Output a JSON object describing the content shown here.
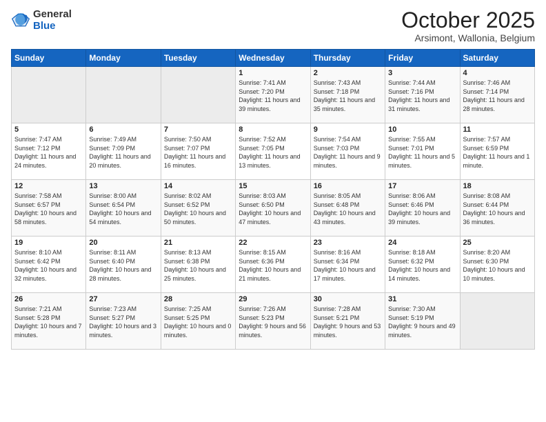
{
  "header": {
    "logo_general": "General",
    "logo_blue": "Blue",
    "month": "October 2025",
    "location": "Arsimont, Wallonia, Belgium"
  },
  "days_of_week": [
    "Sunday",
    "Monday",
    "Tuesday",
    "Wednesday",
    "Thursday",
    "Friday",
    "Saturday"
  ],
  "weeks": [
    [
      {
        "day": "",
        "empty": true
      },
      {
        "day": "",
        "empty": true
      },
      {
        "day": "",
        "empty": true
      },
      {
        "day": "1",
        "sunrise": "7:41 AM",
        "sunset": "7:20 PM",
        "daylight": "11 hours and 39 minutes."
      },
      {
        "day": "2",
        "sunrise": "7:43 AM",
        "sunset": "7:18 PM",
        "daylight": "11 hours and 35 minutes."
      },
      {
        "day": "3",
        "sunrise": "7:44 AM",
        "sunset": "7:16 PM",
        "daylight": "11 hours and 31 minutes."
      },
      {
        "day": "4",
        "sunrise": "7:46 AM",
        "sunset": "7:14 PM",
        "daylight": "11 hours and 28 minutes."
      }
    ],
    [
      {
        "day": "5",
        "sunrise": "7:47 AM",
        "sunset": "7:12 PM",
        "daylight": "11 hours and 24 minutes."
      },
      {
        "day": "6",
        "sunrise": "7:49 AM",
        "sunset": "7:09 PM",
        "daylight": "11 hours and 20 minutes."
      },
      {
        "day": "7",
        "sunrise": "7:50 AM",
        "sunset": "7:07 PM",
        "daylight": "11 hours and 16 minutes."
      },
      {
        "day": "8",
        "sunrise": "7:52 AM",
        "sunset": "7:05 PM",
        "daylight": "11 hours and 13 minutes."
      },
      {
        "day": "9",
        "sunrise": "7:54 AM",
        "sunset": "7:03 PM",
        "daylight": "11 hours and 9 minutes."
      },
      {
        "day": "10",
        "sunrise": "7:55 AM",
        "sunset": "7:01 PM",
        "daylight": "11 hours and 5 minutes."
      },
      {
        "day": "11",
        "sunrise": "7:57 AM",
        "sunset": "6:59 PM",
        "daylight": "11 hours and 1 minute."
      }
    ],
    [
      {
        "day": "12",
        "sunrise": "7:58 AM",
        "sunset": "6:57 PM",
        "daylight": "10 hours and 58 minutes."
      },
      {
        "day": "13",
        "sunrise": "8:00 AM",
        "sunset": "6:54 PM",
        "daylight": "10 hours and 54 minutes."
      },
      {
        "day": "14",
        "sunrise": "8:02 AM",
        "sunset": "6:52 PM",
        "daylight": "10 hours and 50 minutes."
      },
      {
        "day": "15",
        "sunrise": "8:03 AM",
        "sunset": "6:50 PM",
        "daylight": "10 hours and 47 minutes."
      },
      {
        "day": "16",
        "sunrise": "8:05 AM",
        "sunset": "6:48 PM",
        "daylight": "10 hours and 43 minutes."
      },
      {
        "day": "17",
        "sunrise": "8:06 AM",
        "sunset": "6:46 PM",
        "daylight": "10 hours and 39 minutes."
      },
      {
        "day": "18",
        "sunrise": "8:08 AM",
        "sunset": "6:44 PM",
        "daylight": "10 hours and 36 minutes."
      }
    ],
    [
      {
        "day": "19",
        "sunrise": "8:10 AM",
        "sunset": "6:42 PM",
        "daylight": "10 hours and 32 minutes."
      },
      {
        "day": "20",
        "sunrise": "8:11 AM",
        "sunset": "6:40 PM",
        "daylight": "10 hours and 28 minutes."
      },
      {
        "day": "21",
        "sunrise": "8:13 AM",
        "sunset": "6:38 PM",
        "daylight": "10 hours and 25 minutes."
      },
      {
        "day": "22",
        "sunrise": "8:15 AM",
        "sunset": "6:36 PM",
        "daylight": "10 hours and 21 minutes."
      },
      {
        "day": "23",
        "sunrise": "8:16 AM",
        "sunset": "6:34 PM",
        "daylight": "10 hours and 17 minutes."
      },
      {
        "day": "24",
        "sunrise": "8:18 AM",
        "sunset": "6:32 PM",
        "daylight": "10 hours and 14 minutes."
      },
      {
        "day": "25",
        "sunrise": "8:20 AM",
        "sunset": "6:30 PM",
        "daylight": "10 hours and 10 minutes."
      }
    ],
    [
      {
        "day": "26",
        "sunrise": "7:21 AM",
        "sunset": "5:28 PM",
        "daylight": "10 hours and 7 minutes."
      },
      {
        "day": "27",
        "sunrise": "7:23 AM",
        "sunset": "5:27 PM",
        "daylight": "10 hours and 3 minutes."
      },
      {
        "day": "28",
        "sunrise": "7:25 AM",
        "sunset": "5:25 PM",
        "daylight": "10 hours and 0 minutes."
      },
      {
        "day": "29",
        "sunrise": "7:26 AM",
        "sunset": "5:23 PM",
        "daylight": "9 hours and 56 minutes."
      },
      {
        "day": "30",
        "sunrise": "7:28 AM",
        "sunset": "5:21 PM",
        "daylight": "9 hours and 53 minutes."
      },
      {
        "day": "31",
        "sunrise": "7:30 AM",
        "sunset": "5:19 PM",
        "daylight": "9 hours and 49 minutes."
      },
      {
        "day": "",
        "empty": true
      }
    ]
  ]
}
